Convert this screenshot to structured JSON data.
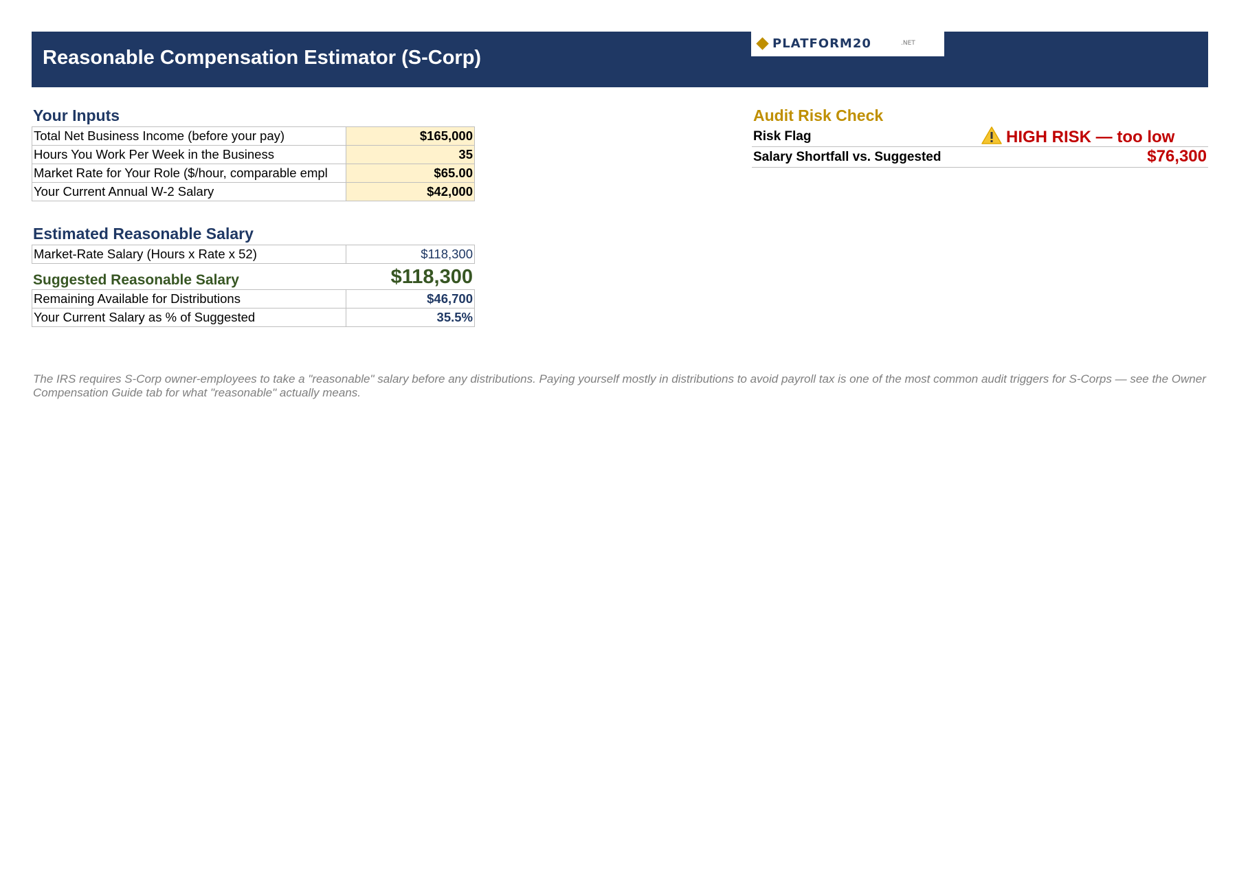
{
  "header": {
    "title": "Reasonable Compensation Estimator (S-Corp)",
    "logo_text": "PLATFORM20",
    "logo_suffix": ".NET"
  },
  "inputs": {
    "title": "Your Inputs",
    "rows": [
      {
        "label": "Total Net Business Income (before your pay)",
        "value": "$165,000"
      },
      {
        "label": "Hours You Work Per Week in the Business",
        "value": "35"
      },
      {
        "label": "Market Rate for Your Role ($/hour, comparable empl",
        "value": "$65.00"
      },
      {
        "label": "Your Current Annual W-2 Salary",
        "value": "$42,000"
      }
    ]
  },
  "estimate": {
    "title": "Estimated Reasonable Salary",
    "market_rate_label": "Market-Rate Salary (Hours x Rate x 52)",
    "market_rate_value": "$118,300",
    "suggested_label": "Suggested Reasonable Salary",
    "suggested_value": "$118,300",
    "remaining_label": "Remaining Available for Distributions",
    "remaining_value": "$46,700",
    "pct_label": "Your Current Salary as % of Suggested",
    "pct_value": "35.5%"
  },
  "audit": {
    "title": "Audit Risk Check",
    "flag_label": "Risk Flag",
    "flag_icon": "warning-icon",
    "flag_value": "HIGH RISK — too low",
    "shortfall_label": "Salary Shortfall vs. Suggested",
    "shortfall_value": "$76,300"
  },
  "note": "The IRS requires S-Corp owner-employees to take a \"reasonable\" salary before any distributions. Paying yourself mostly in distributions to avoid payroll tax is one of the most common audit triggers for S-Corps — see the Owner Compensation Guide tab for what \"reasonable\" actually means.",
  "colors": {
    "banner": "#1f3864",
    "accent_gold": "#bf8f00",
    "input_fill": "#fff2cc",
    "suggested_green": "#375623",
    "risk_red": "#c00000"
  }
}
